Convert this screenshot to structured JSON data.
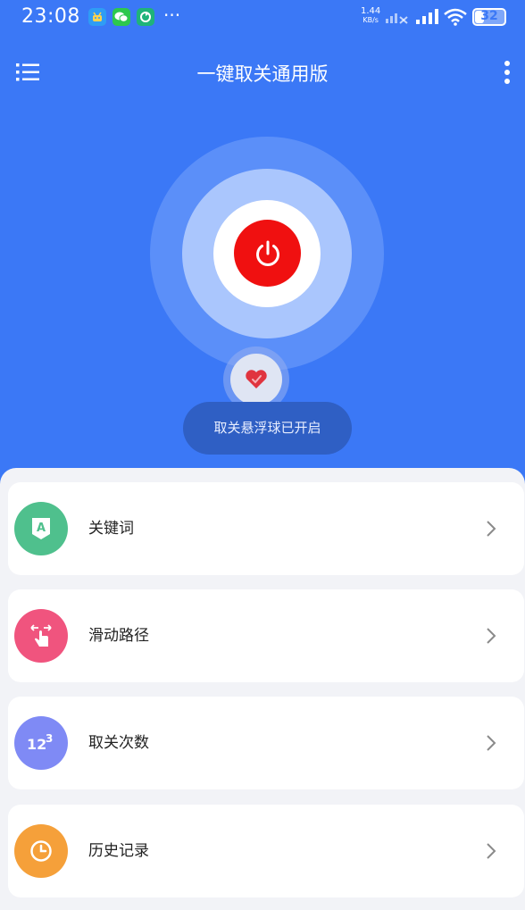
{
  "status_bar": {
    "time": "23:08",
    "net_speed_value": "1.44",
    "net_speed_unit": "KB/s",
    "battery_level": "32",
    "more_notifications": "···",
    "icons": [
      "android-icon",
      "wechat-icon",
      "sync-app-icon",
      "signal-weak-icon",
      "signal-icon",
      "wifi-icon",
      "battery-icon"
    ]
  },
  "header": {
    "title": "一键取关通用版",
    "menu_icon": "list-menu-icon",
    "more_icon": "more-vertical-icon"
  },
  "power": {
    "icon": "power-icon",
    "color": "#f01010"
  },
  "float_ball": {
    "icon": "heart-icon"
  },
  "status_text": "取关悬浮球已开启",
  "colors": {
    "primary": "#3b78f6",
    "keyword": "#4fc08d",
    "swipe": "#f0547e",
    "count": "#7f8af5",
    "history": "#f5a03a"
  },
  "menu_items": [
    {
      "label": "关键词",
      "icon": "keyword-tag-icon"
    },
    {
      "label": "滑动路径",
      "icon": "swipe-gesture-icon"
    },
    {
      "label": "取关次数",
      "icon": "number-123-icon"
    },
    {
      "label": "历史记录",
      "icon": "clock-icon"
    }
  ]
}
